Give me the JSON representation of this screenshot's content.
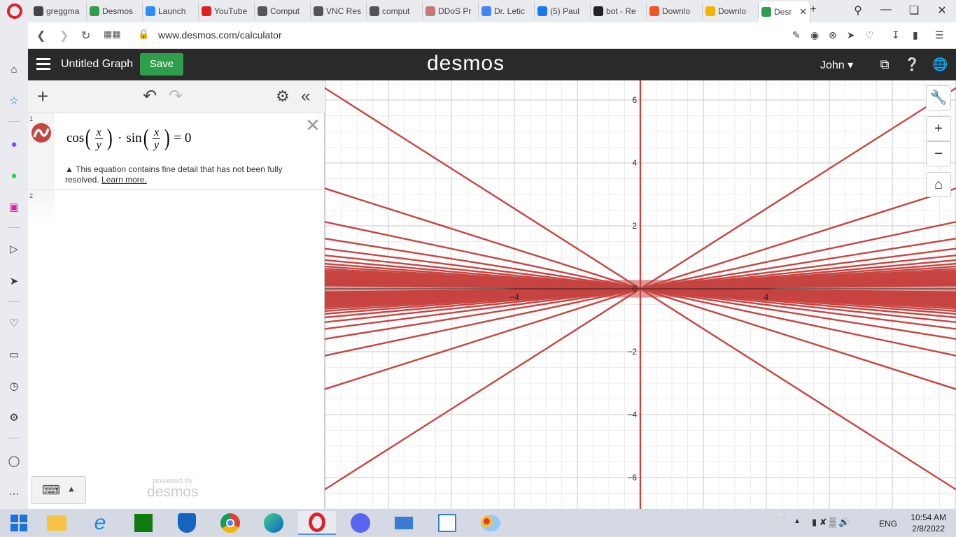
{
  "browser": {
    "tabs": [
      {
        "label": "greggma",
        "color": "#444"
      },
      {
        "label": "Desmos",
        "color": "#2f9e4c"
      },
      {
        "label": "Launch",
        "color": "#2d8cff"
      },
      {
        "label": "YouTube",
        "color": "#e02020"
      },
      {
        "label": "Comput",
        "color": "#555"
      },
      {
        "label": "VNC Res",
        "color": "#555"
      },
      {
        "label": "comput",
        "color": "#555"
      },
      {
        "label": "DDoS Pr",
        "color": "#c77"
      },
      {
        "label": "Dr. Letic",
        "color": "#4285f4"
      },
      {
        "label": "(5) Paul",
        "color": "#1877f2"
      },
      {
        "label": "bot - Re",
        "color": "#222"
      },
      {
        "label": "Downlo",
        "color": "#f35325"
      },
      {
        "label": "Downlo",
        "color": "#f4b400"
      },
      {
        "label": "Desr",
        "color": "#2f9e4c"
      }
    ],
    "url": "www.desmos.com/calculator"
  },
  "desmos": {
    "title": "Untitled Graph",
    "save_label": "Save",
    "brand": "desmos",
    "user": "John",
    "expressions": [
      {
        "num": "1",
        "warning": "This equation contains fine detail that has not been fully resolved.",
        "learn_more": "Learn more."
      },
      {
        "num": "2"
      }
    ],
    "eq": {
      "cos": "cos",
      "sin": "sin",
      "x": "x",
      "y": "y",
      "dot": "·",
      "rhs": "= 0"
    },
    "powered_by": "powered by",
    "powered_brand": "desmos"
  },
  "chart_data": {
    "type": "line",
    "equation": "cos(x/y)·sin(x/y)=0",
    "xlim": [
      -10,
      10
    ],
    "ylim": [
      -7,
      6.6
    ],
    "x_ticks": [
      -4,
      4
    ],
    "y_ticks": [
      6,
      4,
      2,
      0,
      -2,
      -4,
      -6
    ],
    "line_color": "#c74440",
    "grid": true
  },
  "taskbar": {
    "time": "10:54 AM",
    "date": "2/8/2022",
    "lang": "ENG"
  }
}
